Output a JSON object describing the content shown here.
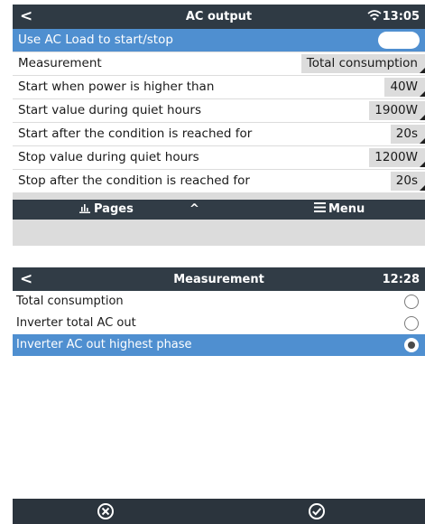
{
  "ac_output": {
    "header": {
      "back_glyph": "<",
      "title": "AC output",
      "time": "13:05",
      "status_icon": "wifi-icon"
    },
    "rows": [
      {
        "label": "Use AC Load to start/stop",
        "control": "toggle",
        "toggle_on": false
      },
      {
        "label": "Measurement",
        "value": "Total consumption"
      },
      {
        "label": "Start when power is higher than",
        "value": "40W"
      },
      {
        "label": "Start value during quiet hours",
        "value": "1900W"
      },
      {
        "label": "Start after the condition is reached for",
        "value": "20s"
      },
      {
        "label": "Stop value during quiet hours",
        "value": "1200W"
      },
      {
        "label": "Stop after the condition is reached for",
        "value": "20s"
      }
    ],
    "footer": {
      "pages_label": "Pages",
      "up_glyph": "^",
      "menu_label": "Menu"
    }
  },
  "measurement": {
    "header": {
      "back_glyph": "<",
      "title": "Measurement",
      "time": "12:28"
    },
    "options": [
      {
        "label": "Total consumption",
        "selected": false
      },
      {
        "label": "Inverter total AC out",
        "selected": false
      },
      {
        "label": "Inverter AC out highest phase",
        "selected": true
      }
    ],
    "footer": {
      "cancel_icon": "cancel-circle-icon",
      "confirm_icon": "confirm-check-icon"
    }
  },
  "colors": {
    "header_bg": "#2f3a44",
    "highlight": "#4f8fd0",
    "row_bg": "#ffffff",
    "value_box": "#dcdcdc"
  }
}
